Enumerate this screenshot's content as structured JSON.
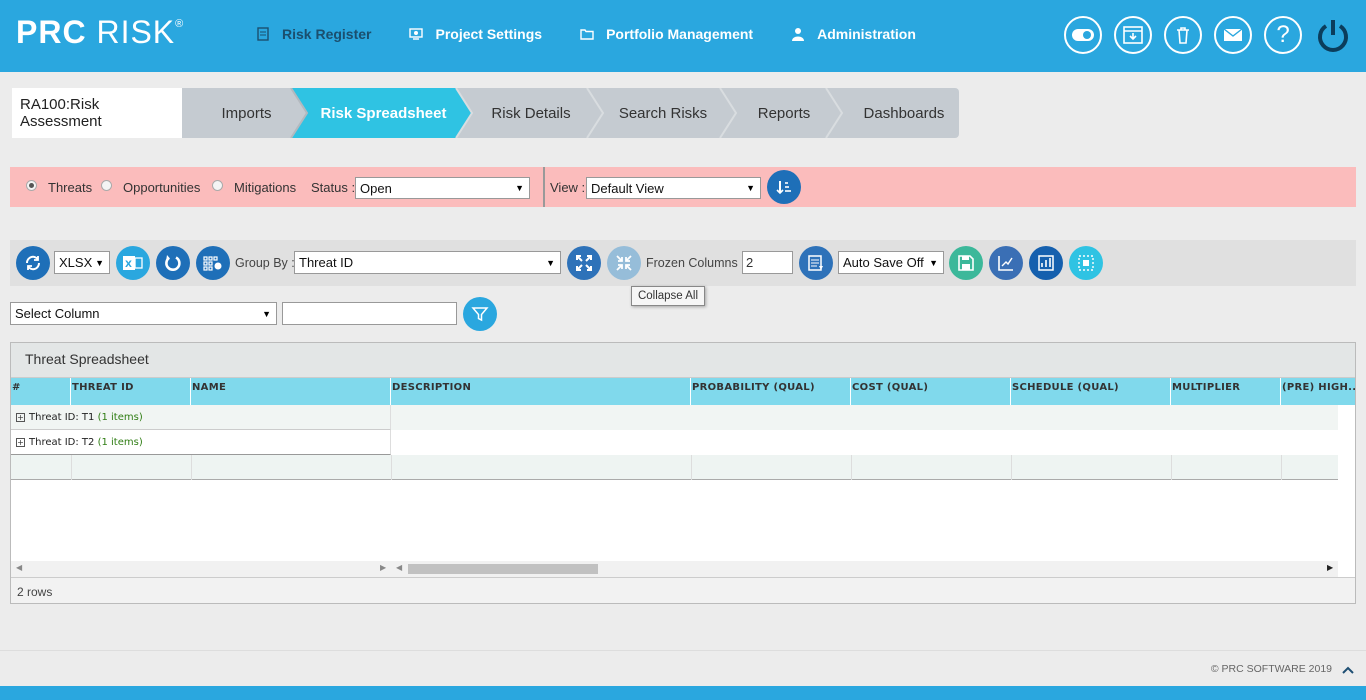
{
  "app": {
    "logo_bold": "PRC",
    "logo_rest": "RISK",
    "logo_reg": "®"
  },
  "nav": [
    {
      "label": "Risk Register",
      "icon": "register-icon"
    },
    {
      "label": "Project Settings",
      "icon": "settings-icon"
    },
    {
      "label": "Portfolio Management",
      "icon": "folder-icon"
    },
    {
      "label": "Administration",
      "icon": "user-icon"
    }
  ],
  "top_icons": [
    "toggle-icon",
    "download-icon",
    "trash-icon",
    "mail-icon",
    "help-icon",
    "power-icon"
  ],
  "breadcrumb": {
    "project": "RA100:Risk Assessment",
    "steps": [
      "Imports",
      "Risk Spreadsheet",
      "Risk Details",
      "Search Risks",
      "Reports",
      "Dashboards"
    ],
    "active_step": "Risk Spreadsheet"
  },
  "filters": {
    "types": [
      {
        "label": "Threats",
        "selected": true
      },
      {
        "label": "Opportunities",
        "selected": false
      },
      {
        "label": "Mitigations",
        "selected": false
      }
    ],
    "status_label": "Status :",
    "status_value": "Open",
    "view_label": "View :",
    "view_value": "Default View"
  },
  "toolbar": {
    "format": "XLSX",
    "group_by_label": "Group By :",
    "group_by_value": "Threat ID",
    "frozen_label": "Frozen Columns :",
    "frozen_value": "2",
    "autosave": "Auto Save Off",
    "tooltip": "Collapse All"
  },
  "column_filter": {
    "select_value": "Select Column",
    "text_value": ""
  },
  "grid": {
    "title": "Threat Spreadsheet",
    "columns": [
      "#",
      "THREAT ID",
      "NAME",
      "DESCRIPTION",
      "PROBABILITY (QUAL)",
      "COST (QUAL)",
      "SCHEDULE (QUAL)",
      "MULTIPLIER",
      "(PRE) HIGH..."
    ],
    "groups": [
      {
        "prefix": "Threat ID: T1",
        "count": "(1 items)"
      },
      {
        "prefix": "Threat ID: T2",
        "count": "(1 items)"
      }
    ],
    "row_count": "2 rows"
  },
  "footer": {
    "copyright": "© PRC SOFTWARE 2019"
  },
  "colors": {
    "brand": "#2aa7df",
    "active_step": "#2fc3e3",
    "filter_bar": "#fbbcbc",
    "grid_header": "#80d9ec",
    "btn_blue": "#1e6fb8",
    "btn_teal": "#3cb89a"
  }
}
